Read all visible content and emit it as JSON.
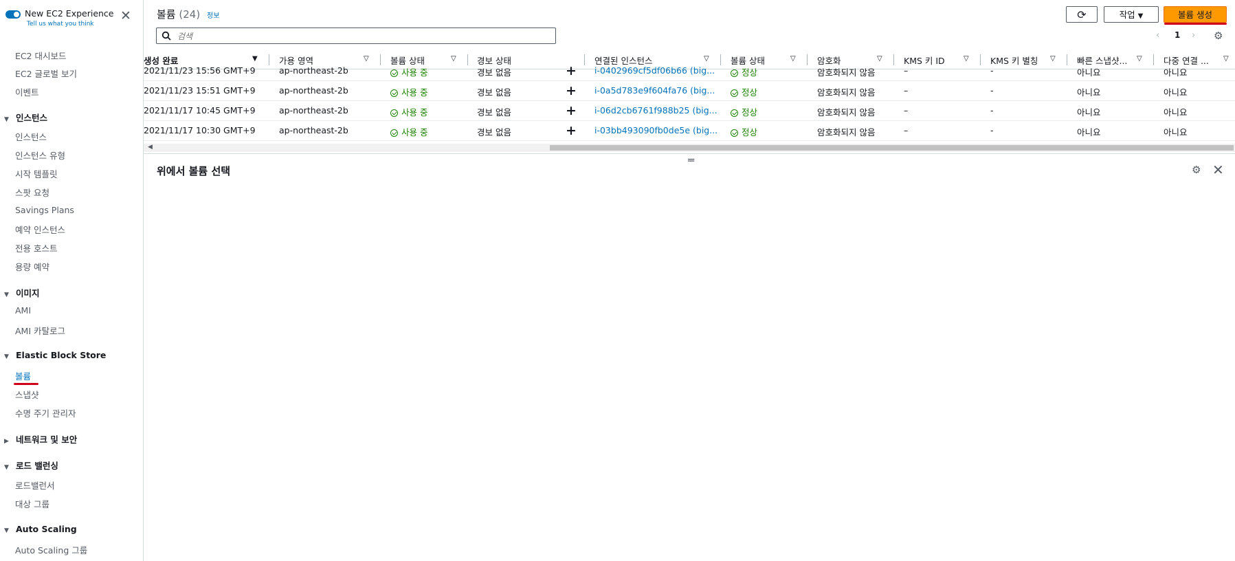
{
  "sidebar": {
    "toggle_title": "New EC2 Experience",
    "toggle_sub": "Tell us what you think",
    "top_items": [
      "EC2 대시보드",
      "EC2 글로벌 보기",
      "이벤트"
    ],
    "sections": [
      {
        "title": "인스턴스",
        "expanded": true,
        "items": [
          "인스턴스",
          "인스턴스 유형",
          "시작 템플릿",
          "스팟 요청",
          "Savings Plans",
          "예약 인스턴스",
          "전용 호스트",
          "용량 예약"
        ]
      },
      {
        "title": "이미지",
        "expanded": true,
        "items": [
          "AMI",
          "AMI 카탈로그"
        ]
      },
      {
        "title": "Elastic Block Store",
        "expanded": true,
        "items": [
          "볼륨",
          "스냅샷",
          "수명 주기 관리자"
        ]
      },
      {
        "title": "네트워크 및 보안",
        "expanded": false,
        "items": []
      },
      {
        "title": "로드 밸런싱",
        "expanded": true,
        "items": [
          "로드밸런서",
          "대상 그룹"
        ]
      },
      {
        "title": "Auto Scaling",
        "expanded": true,
        "items": [
          "Auto Scaling 그룹"
        ]
      }
    ],
    "active_item": "볼륨"
  },
  "header": {
    "title": "볼륨",
    "count": "(24)",
    "info": "정보",
    "actions_label": "작업",
    "create_label": "볼륨 생성",
    "search_placeholder": "검색",
    "page": "1"
  },
  "table": {
    "columns": [
      "생성 완료",
      "가용 영역",
      "볼륨 상태",
      "경보 상태",
      "연결된 인스턴스",
      "볼륨 상태",
      "암호화",
      "KMS 키 ID",
      "KMS 키 별칭",
      "빠른 스냅샷...",
      "다중 연결 ..."
    ],
    "rows": [
      {
        "created": "2021/11/23 15:56 GMT+9",
        "az": "ap-northeast-2b",
        "vol_state": "사용 중",
        "alarm": "경보 없음",
        "instance": "i-0402969cf5df06b66 (big...",
        "status": "정상",
        "encryption": "암호화되지 않음",
        "kms_id": "–",
        "kms_alias": "-",
        "fast_snapshot": "아니요",
        "multi_attach": "아니요"
      },
      {
        "created": "2021/11/23 15:51 GMT+9",
        "az": "ap-northeast-2b",
        "vol_state": "사용 중",
        "alarm": "경보 없음",
        "instance": "i-0a5d783e9f604fa76 (big...",
        "status": "정상",
        "encryption": "암호화되지 않음",
        "kms_id": "–",
        "kms_alias": "-",
        "fast_snapshot": "아니요",
        "multi_attach": "아니요"
      },
      {
        "created": "2021/11/17 10:45 GMT+9",
        "az": "ap-northeast-2b",
        "vol_state": "사용 중",
        "alarm": "경보 없음",
        "instance": "i-06d2cb6761f988b25 (big...",
        "status": "정상",
        "encryption": "암호화되지 않음",
        "kms_id": "–",
        "kms_alias": "-",
        "fast_snapshot": "아니요",
        "multi_attach": "아니요"
      },
      {
        "created": "2021/11/17 10:30 GMT+9",
        "az": "ap-northeast-2b",
        "vol_state": "사용 중",
        "alarm": "경보 없음",
        "instance": "i-03bb493090fb0de5e (big...",
        "status": "정상",
        "encryption": "암호화되지 않음",
        "kms_id": "–",
        "kms_alias": "-",
        "fast_snapshot": "아니요",
        "multi_attach": "아니요"
      }
    ]
  },
  "details": {
    "title": "위에서 볼륨 선택"
  },
  "colors": {
    "accent": "#0073bb",
    "primary_button": "#ff9900",
    "success": "#1d8102",
    "annotation": "#d0021b"
  }
}
